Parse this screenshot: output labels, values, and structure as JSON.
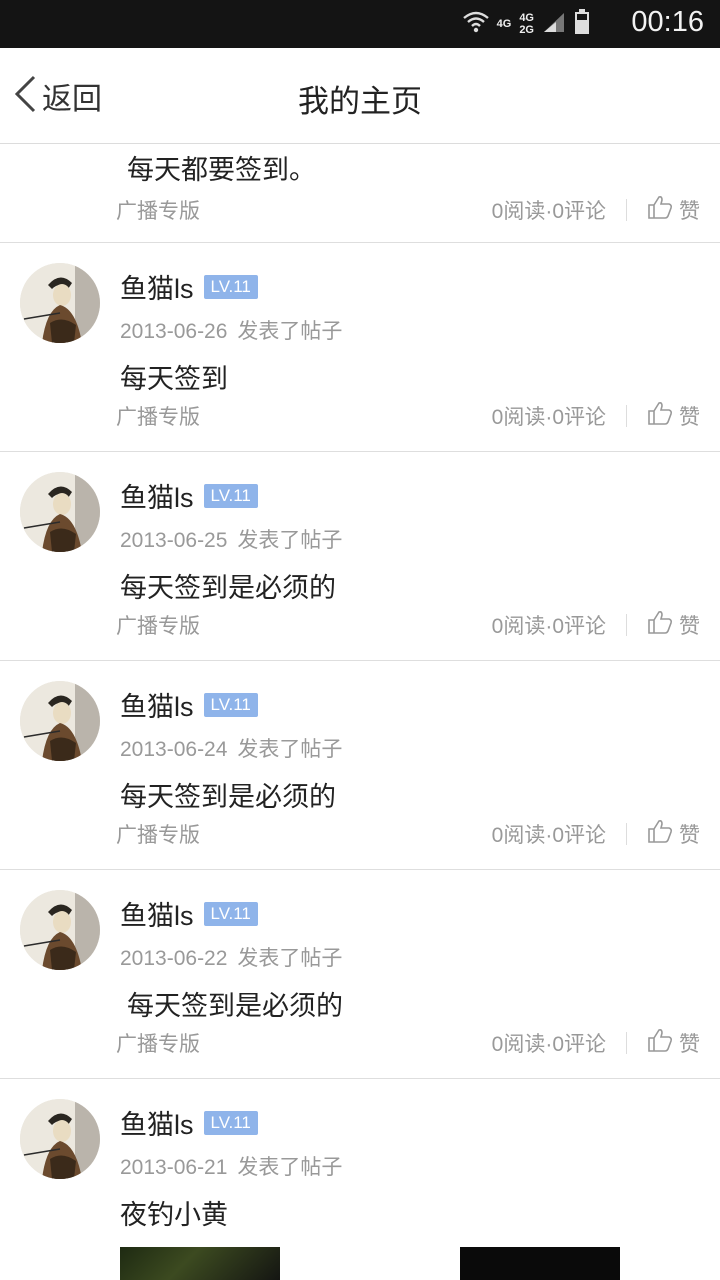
{
  "status_bar": {
    "time": "00:16",
    "net1_top": "4G",
    "net2_top": "4G",
    "net2_bottom": "2G"
  },
  "nav": {
    "back_label": "返回",
    "title": "我的主页"
  },
  "posts": [
    {
      "content": "每天都要签到。",
      "board": "广播专版",
      "stats": "0阅读·0评论",
      "like": "赞"
    },
    {
      "username": "鱼猫ls",
      "level": "LV.11",
      "date": "2013-06-26",
      "action": "发表了帖子",
      "content": "每天签到",
      "board": "广播专版",
      "stats": "0阅读·0评论",
      "like": "赞"
    },
    {
      "username": "鱼猫ls",
      "level": "LV.11",
      "date": "2013-06-25",
      "action": "发表了帖子",
      "content": "每天签到是必须的",
      "board": "广播专版",
      "stats": "0阅读·0评论",
      "like": "赞"
    },
    {
      "username": "鱼猫ls",
      "level": "LV.11",
      "date": "2013-06-24",
      "action": "发表了帖子",
      "content": "每天签到是必须的",
      "board": "广播专版",
      "stats": "0阅读·0评论",
      "like": "赞"
    },
    {
      "username": "鱼猫ls",
      "level": "LV.11",
      "date": "2013-06-22",
      "action": "发表了帖子",
      "content": "每天签到是必须的",
      "board": "广播专版",
      "stats": "0阅读·0评论",
      "like": "赞"
    },
    {
      "username": "鱼猫ls",
      "level": "LV.11",
      "date": "2013-06-21",
      "action": "发表了帖子",
      "content": "夜钓小黄"
    }
  ],
  "colors": {
    "status_bar_bg": "#141414",
    "level_badge_bg": "#8fb4ea",
    "secondary_text": "#999999",
    "divider": "#dedede"
  },
  "icons": [
    "wifi-icon",
    "signal-icon",
    "battery-icon",
    "back-chevron-icon",
    "thumbs-up-icon",
    "avatar-image"
  ]
}
